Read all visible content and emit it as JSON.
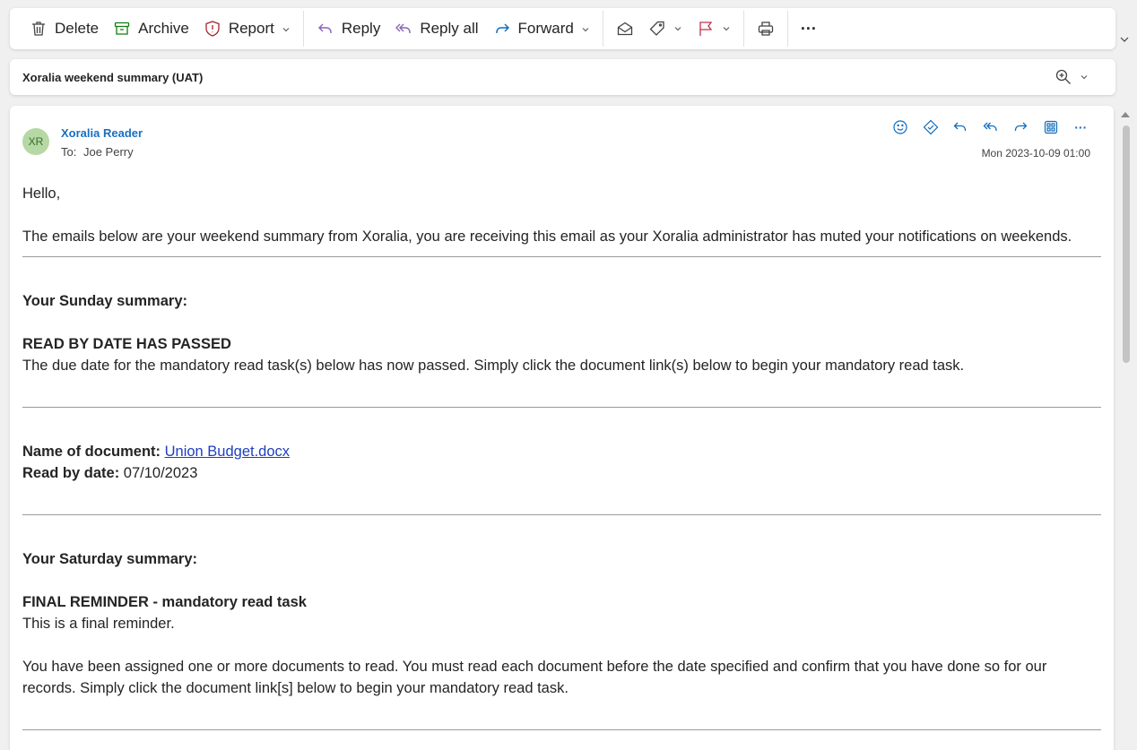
{
  "toolbar": {
    "delete_label": "Delete",
    "archive_label": "Archive",
    "report_label": "Report",
    "reply_label": "Reply",
    "reply_all_label": "Reply all",
    "forward_label": "Forward",
    "more_label": "···"
  },
  "subject_bar": {
    "subject": "Xoralia weekend summary (UAT)"
  },
  "message": {
    "avatar_initials": "XR",
    "sender": "Xoralia Reader",
    "to_prefix": "To:",
    "to": "Joe Perry",
    "date": "Mon 2023-10-09 01:00",
    "more_label": "···"
  },
  "body": {
    "greeting": "Hello,",
    "intro": "The emails below are your weekend summary from Xoralia, you are receiving this email as your Xoralia administrator has muted your notifications on weekends.",
    "sunday_heading": "Your Sunday summary:",
    "sunday_title": "READ BY DATE HAS PASSED",
    "sunday_text": "The due date for the mandatory read task(s) below has now passed. Simply click the document link(s) below to begin your mandatory read task.",
    "doc_name_label": "Name of document:",
    "doc_name": "Union Budget.docx",
    "read_by_label": "Read by date:",
    "read_by_date": "07/10/2023",
    "saturday_heading": "Your Saturday summary:",
    "saturday_title": "FINAL REMINDER - mandatory read task",
    "saturday_text1": "This is a final reminder.",
    "saturday_text2": "You have been assigned one or more documents to read. You must read each document before the date specified and confirm that you have done so for our records. Simply click the document link[s] below to begin your mandatory read task."
  },
  "colors": {
    "link": "#1d3fc2",
    "sender": "#1a6fc1",
    "avatar_bg": "#b5d8a4",
    "archive_icon": "#107c10",
    "report_icon": "#a4262c",
    "reply_icon": "#8764b8",
    "forward_icon": "#0f6cbd",
    "flag_icon": "#c4314b"
  },
  "icons": [
    "trash-icon",
    "archive-icon",
    "shield-icon",
    "reply-icon",
    "reply-all-icon",
    "forward-icon",
    "envelope-open-icon",
    "tag-icon",
    "flag-icon",
    "printer-icon",
    "more-icon",
    "zoom-icon",
    "emoji-icon",
    "sticker-icon",
    "apps-icon"
  ]
}
